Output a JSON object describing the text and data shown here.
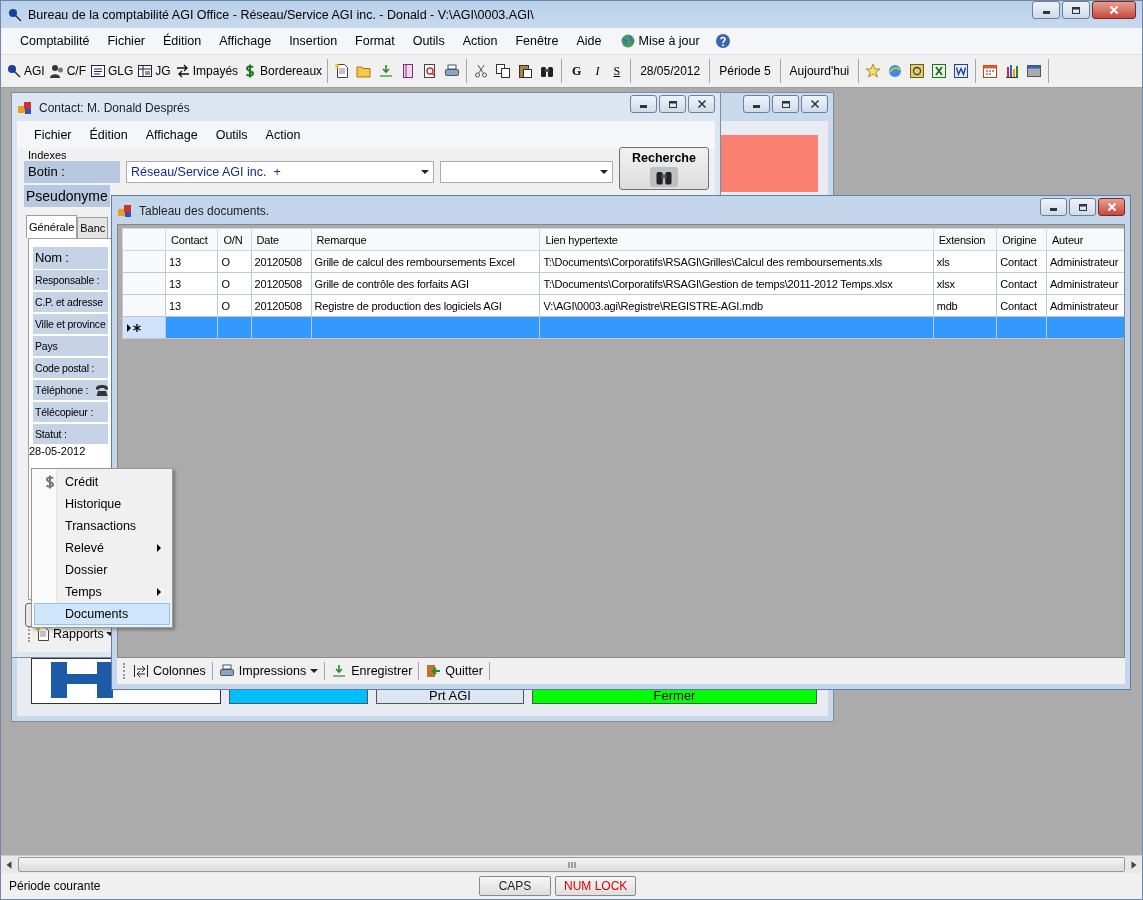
{
  "window": {
    "title": "Bureau de la comptabilité AGI Office - Réseau/Service AGI inc. - Donald - V:\\AGI\\0003.AGI\\"
  },
  "menu": [
    "Comptabilité",
    "Fichier",
    "Édition",
    "Affichage",
    "Insertion",
    "Format",
    "Outils",
    "Action",
    "Fenêtre",
    "Aide"
  ],
  "update_link": "Mise à jour",
  "toolbar": {
    "shortcuts": [
      "AGI",
      "C/F",
      "GLG",
      "JG",
      "Impayés",
      "Bordereaux"
    ],
    "format": [
      {
        "label": "G",
        "kind": "bold"
      },
      {
        "label": "I",
        "kind": "italic"
      },
      {
        "label": "S",
        "kind": "underline"
      }
    ],
    "date": "28/05/2012",
    "period": "Période 5",
    "today": "Aujourd'hui"
  },
  "back_window": {
    "buttons": [
      {
        "color": "#00bfff"
      },
      {
        "label": "Prt AGI",
        "color": "#dce6f1"
      },
      {
        "label": "Fermer",
        "color": "#00ff00"
      }
    ]
  },
  "contact_window": {
    "title": "Contact: M. Donald Després",
    "menu": [
      "Fichier",
      "Édition",
      "Affichage",
      "Outils",
      "Action"
    ],
    "group": "Indexes",
    "botin_label": "Botin :",
    "botin_value": "Réseau/Service AGI inc.  +",
    "pseudonym_label": "Pseudonyme",
    "search_button": "Recherche",
    "tabs": [
      {
        "label": "Générale",
        "selected": true
      },
      {
        "label": "Banc",
        "selected": false
      }
    ],
    "fields": [
      {
        "label": "Nom :",
        "kind": "large"
      },
      {
        "label": "Responsable :",
        "kind": "normal"
      },
      {
        "label": "C.P. et adresse",
        "kind": "normal"
      },
      {
        "label": "Ville et province",
        "kind": "normal"
      },
      {
        "label": "Pays",
        "kind": "normal"
      },
      {
        "label": "Code postal :",
        "kind": "normal"
      },
      {
        "label": "Téléphone :",
        "kind": "phone"
      },
      {
        "label": "Télécopieur :",
        "kind": "normal"
      },
      {
        "label": "Statut :",
        "kind": "normal"
      }
    ],
    "date": "28-05-2012",
    "reports_button": "Rapports"
  },
  "documents_window": {
    "title": "Tableau des documents.",
    "columns": [
      "Contact",
      "O/N",
      "Date",
      "Remarque",
      "Lien hypertexte",
      "Extension",
      "Origine",
      "Auteur"
    ],
    "rows": [
      {
        "kind": "data",
        "selected": false,
        "cells": [
          "13",
          "O",
          "20120508",
          "Grille de calcul des remboursements Excel",
          "T:\\Documents\\Corporatifs\\RSAGI\\Grilles\\Calcul des remboursements.xls",
          "xls",
          "Contact",
          "Administrateur"
        ]
      },
      {
        "kind": "data",
        "selected": false,
        "cells": [
          "13",
          "O",
          "20120508",
          "Grille de contrôle des forfaits AGI",
          "T:\\Documents\\Corporatifs\\RSAGI\\Gestion de temps\\2011-2012 Temps.xlsx",
          "xlsx",
          "Contact",
          "Administrateur"
        ]
      },
      {
        "kind": "data",
        "selected": false,
        "cells": [
          "13",
          "O",
          "20120508",
          "Registre de production des logiciels AGI",
          "V:\\AGI\\0003.agi\\Registre\\REGISTRE-AGI.mdb",
          "mdb",
          "Contact",
          "Administrateur"
        ]
      },
      {
        "kind": "new",
        "selected": true
      }
    ],
    "toolbar": [
      {
        "label": "Colonnes",
        "dropdown": false
      },
      {
        "label": "Impressions",
        "dropdown": true
      },
      {
        "label": "Enregistrer",
        "dropdown": false
      },
      {
        "label": "Quitter",
        "dropdown": false
      }
    ]
  },
  "context_menu": [
    {
      "label": "Crédit",
      "submenu": false,
      "selected": false
    },
    {
      "label": "Historique",
      "submenu": false,
      "selected": false
    },
    {
      "label": "Transactions",
      "submenu": false,
      "selected": false
    },
    {
      "label": "Relevé",
      "submenu": true,
      "selected": false
    },
    {
      "label": "Dossier",
      "submenu": false,
      "selected": false
    },
    {
      "label": "Temps",
      "submenu": true,
      "selected": false
    },
    {
      "label": "Documents",
      "submenu": false,
      "selected": true
    }
  ],
  "status_bar": {
    "text": "Période courante",
    "keys": [
      {
        "label": "CAPS",
        "on": false
      },
      {
        "label": "NUM LOCK",
        "on": true
      }
    ]
  }
}
